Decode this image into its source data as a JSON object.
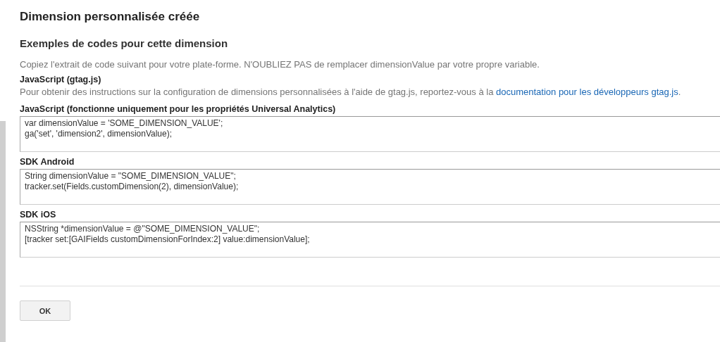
{
  "dialog": {
    "title": "Dimension personnalisée créée",
    "subtitle": "Exemples de codes pour cette dimension",
    "intro": "Copiez l'extrait de code suivant pour votre plate-forme. N'OUBLIEZ PAS de remplacer dimensionValue par votre propre variable.",
    "gtag": {
      "heading": "JavaScript (gtag.js)",
      "text": "Pour obtenir des instructions sur la configuration de dimensions personnalisées à l'aide de gtag.js, reportez-vous à la ",
      "link": "documentation pour les développeurs gtag.js",
      "after": "."
    },
    "snippets": [
      {
        "label": "JavaScript (fonctionne uniquement pour les propriétés Universal Analytics)",
        "lines": [
          "var dimensionValue = 'SOME_DIMENSION_VALUE';",
          "ga('set', 'dimension2', dimensionValue);"
        ]
      },
      {
        "label": "SDK Android",
        "lines": [
          "String dimensionValue = \"SOME_DIMENSION_VALUE\";",
          "tracker.set(Fields.customDimension(2), dimensionValue);"
        ]
      },
      {
        "label": "SDK iOS",
        "lines": [
          "NSString *dimensionValue = @\"SOME_DIMENSION_VALUE\";",
          "[tracker set:[GAIFields customDimensionForIndex:2] value:dimensionValue];"
        ]
      }
    ],
    "buttons": [
      "OK"
    ]
  }
}
